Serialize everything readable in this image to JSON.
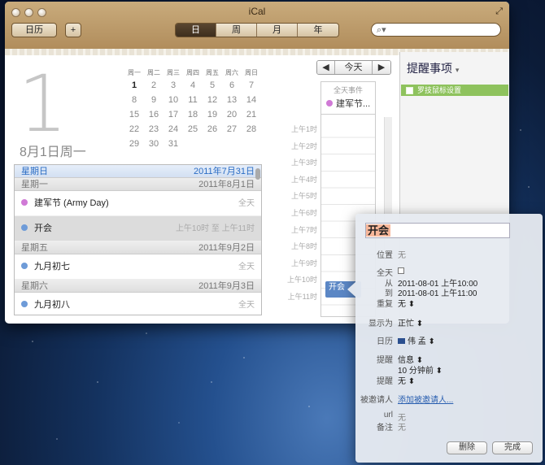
{
  "window": {
    "title": "iCal",
    "calendars_button": "日历",
    "add_button": "+",
    "view_tabs": [
      {
        "label": "日",
        "active": true
      },
      {
        "label": "周",
        "active": false
      },
      {
        "label": "月",
        "active": false
      },
      {
        "label": "年",
        "active": false
      }
    ],
    "search_placeholder": ""
  },
  "day_header": {
    "big_day": "1",
    "date_label": "8月1日周一"
  },
  "mini_calendar": {
    "weekdays": [
      "周一",
      "周二",
      "周三",
      "周四",
      "周五",
      "周六",
      "周日"
    ],
    "rows": [
      [
        "1",
        "2",
        "3",
        "4",
        "5",
        "6",
        "7"
      ],
      [
        "8",
        "9",
        "10",
        "11",
        "12",
        "13",
        "14"
      ],
      [
        "15",
        "16",
        "17",
        "18",
        "19",
        "20",
        "21"
      ],
      [
        "22",
        "23",
        "24",
        "25",
        "26",
        "27",
        "28"
      ],
      [
        "29",
        "30",
        "31",
        "",
        "",
        "",
        ""
      ]
    ],
    "today": "1"
  },
  "agenda": [
    {
      "type": "sep",
      "day": "星期日",
      "date": "2011年7月31日",
      "highlight": true
    },
    {
      "type": "sep",
      "day": "星期一",
      "date": "2011年8月1日"
    },
    {
      "type": "item",
      "title": "建军节 (Army Day)",
      "time": "全天",
      "color": "#d07ad6"
    },
    {
      "type": "item",
      "title": "开会",
      "time": "上午10时 至 上午11时",
      "color": "#6e9bd8",
      "selected": true
    },
    {
      "type": "sep",
      "day": "星期五",
      "date": "2011年9月2日"
    },
    {
      "type": "item",
      "title": "九月初七",
      "time": "全天",
      "color": "#6e9bd8"
    },
    {
      "type": "sep",
      "day": "星期六",
      "date": "2011年9月3日"
    },
    {
      "type": "item",
      "title": "九月初八",
      "time": "全天",
      "color": "#6e9bd8"
    }
  ],
  "day_view": {
    "nav_prev": "◀",
    "nav_today": "今天",
    "nav_next": "▶",
    "allday_label": "全天事件",
    "allday_event": "建军节...",
    "hours": [
      "上午1时",
      "上午2时",
      "上午3时",
      "上午4时",
      "上午5时",
      "上午6时",
      "上午7时",
      "上午8时",
      "上午9时",
      "上午10时",
      "上午11时"
    ],
    "event_label": "开会"
  },
  "reminders": {
    "title": "提醒事项",
    "items": [
      "罗技鼠标设置"
    ]
  },
  "event_popover": {
    "title": "开会",
    "location_label": "位置",
    "location_value": "无",
    "allday_label": "全天",
    "from_label": "从",
    "from_value": "2011-08-01 上午10:00",
    "to_label": "到",
    "to_value": "2011-08-01 上午11:00",
    "repeat_label": "重复",
    "repeat_value": "无",
    "show_as_label": "显示为",
    "show_as_value": "正忙",
    "calendar_label": "日历",
    "calendar_value": "伟 孟",
    "alert_label": "提醒",
    "alert_value": "信息",
    "alert_time": "10 分钟前",
    "alert2_label": "提醒",
    "alert2_value": "无",
    "invitees_label": "被邀请人",
    "invitees_value": "添加被邀请人...",
    "url_label": "url",
    "url_value": "无",
    "notes_label": "备注",
    "notes_value": "无",
    "delete_button": "删除",
    "done_button": "完成"
  },
  "colors": {
    "accent_blue": "#2a6cc4",
    "reminder_green": "#8ec25d",
    "event_blue": "#5b87c5"
  }
}
